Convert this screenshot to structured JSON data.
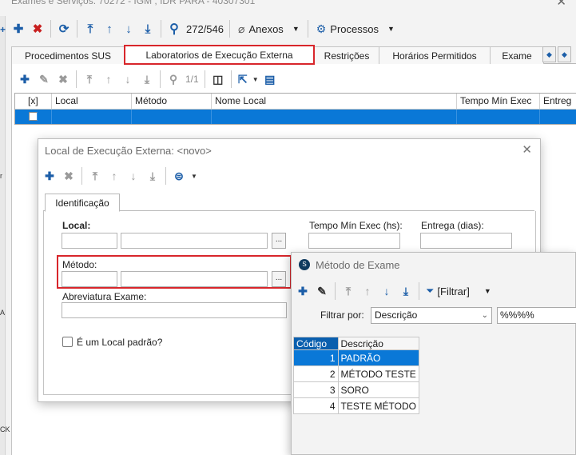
{
  "window": {
    "title": "Exames e Serviços: 70272 - IGM , IDR PARA - 40307301",
    "close_glyph": "✕"
  },
  "left_strip_marks": [
    "+",
    "r",
    "A",
    "CK"
  ],
  "toolbar": {
    "record_position": "272/546",
    "attachments_label": "Anexos",
    "processes_label": "Processos"
  },
  "tabs": [
    "Procedimentos SUS",
    "Laboratorios de Execução Externa",
    "Restrições",
    "Horários Permitidos",
    "Exame"
  ],
  "panel": {
    "page_indicator": "1/1",
    "grid_columns": [
      "[x]",
      "Local",
      "Método",
      "Nome Local",
      "Tempo Mín Exec",
      "Entreg"
    ]
  },
  "local_dialog": {
    "title": "Local de Execução Externa: <novo>",
    "close_glyph": "✕",
    "tab_label": "Identificação",
    "local_label": "Local:",
    "tempo_label": "Tempo Mín Exec (hs):",
    "entrega_label": "Entrega (dias):",
    "metodo_label": "Método:",
    "abreviatura_label": "Abreviatura Exame:",
    "padrao_label": "É um Local padrão?",
    "lookup_button": "..."
  },
  "metodo_dialog": {
    "title": "Método de Exame",
    "logo_glyph": "S",
    "filter_button": "[Filtrar]",
    "filter_by_label": "Filtrar por:",
    "filter_field": "Descrição",
    "filter_value": "%%%%",
    "columns": [
      "Código",
      "Descrição"
    ],
    "rows": [
      {
        "codigo": "1",
        "descricao": "PADRÃO"
      },
      {
        "codigo": "2",
        "descricao": "MÉTODO TESTE"
      },
      {
        "codigo": "3",
        "descricao": "SORO"
      },
      {
        "codigo": "4",
        "descricao": "TESTE MÉTODO"
      }
    ],
    "selected_row": 0
  },
  "colors": {
    "accent_blue": "#0a78d7",
    "highlight_red": "#d8262b",
    "icon_blue": "#1c5ea8",
    "delete_red": "#c82020"
  }
}
